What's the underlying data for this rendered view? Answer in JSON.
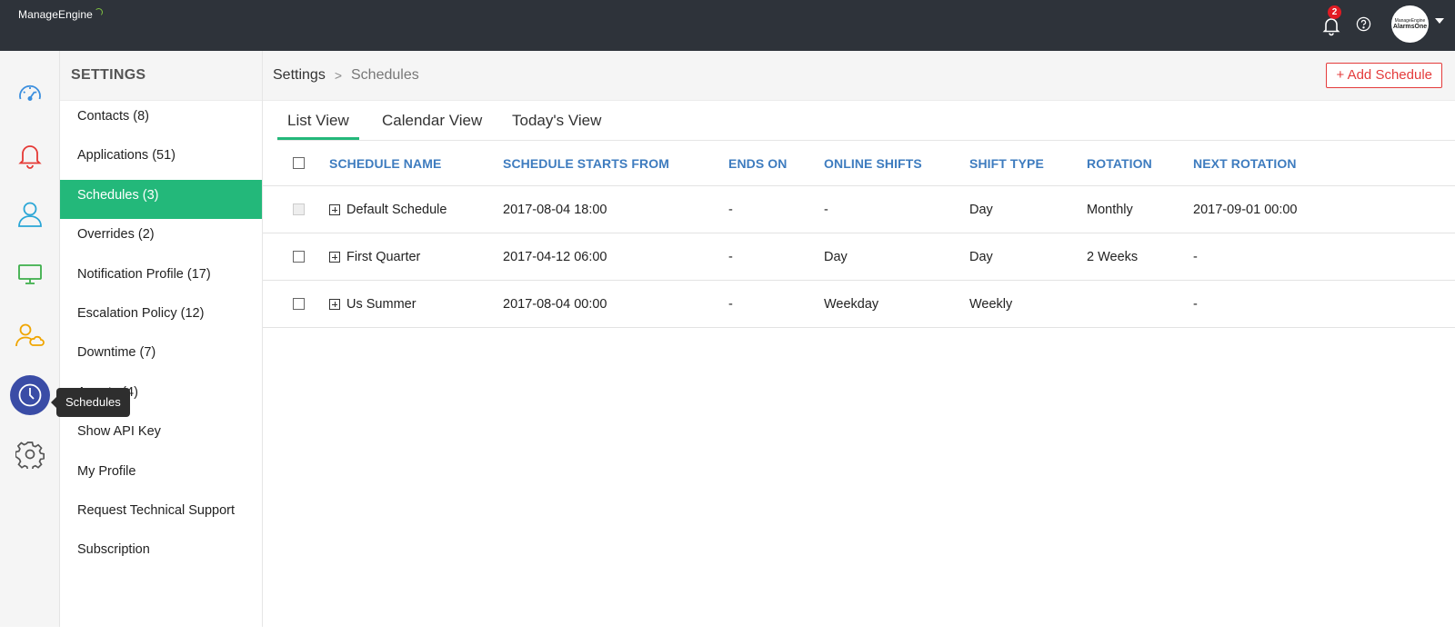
{
  "brand": {
    "vendor": "ManageEngine",
    "product": "AlarmsOne"
  },
  "topbar": {
    "notification_count": "2",
    "avatar_vendor": "ManageEngine",
    "avatar_product": "AlarmsOne"
  },
  "rail": {
    "items": [
      {
        "icon": "dashboard-gauge-icon",
        "color": "#3a8ede"
      },
      {
        "icon": "alarm-bell-icon",
        "color": "#e53935"
      },
      {
        "icon": "user-icon",
        "color": "#2aa6d6"
      },
      {
        "icon": "monitor-icon",
        "color": "#3cae4a"
      },
      {
        "icon": "users-cloud-icon",
        "color": "#f0a500"
      },
      {
        "icon": "clock-icon",
        "color": "#ffffff",
        "active": true
      },
      {
        "icon": "gear-icon",
        "color": "#555555"
      }
    ],
    "tooltip": "Schedules"
  },
  "settings": {
    "title": "SETTINGS",
    "items": [
      {
        "label": "Contacts (8)"
      },
      {
        "label": "Applications (51)"
      },
      {
        "label": "Schedules (3)",
        "active": true
      },
      {
        "label": "Overrides (2)"
      },
      {
        "label": "Notification Profile (17)"
      },
      {
        "label": "Escalation Policy (12)"
      },
      {
        "label": "Downtime (7)"
      },
      {
        "label": "Agents (4)"
      },
      {
        "label": "Show API Key"
      },
      {
        "label": "My Profile"
      },
      {
        "label": "Request Technical Support"
      },
      {
        "label": "Subscription"
      }
    ]
  },
  "breadcrumb": {
    "root": "Settings",
    "separator": ">",
    "current": "Schedules"
  },
  "add_button": "+ Add Schedule",
  "tabs": [
    {
      "label": "List View",
      "active": true
    },
    {
      "label": "Calendar View"
    },
    {
      "label": "Today's View"
    }
  ],
  "table": {
    "columns": [
      "SCHEDULE NAME",
      "SCHEDULE STARTS FROM",
      "ENDS ON",
      "ONLINE SHIFTS",
      "SHIFT TYPE",
      "ROTATION",
      "NEXT ROTATION"
    ],
    "rows": [
      {
        "name": "Default Schedule",
        "starts": "2017-08-04 18:00",
        "ends": "-",
        "online": "-",
        "shift_type": "Day",
        "rotation": "Monthly",
        "next_rotation": "2017-09-01 00:00"
      },
      {
        "name": "First Quarter",
        "starts": "2017-04-12 06:00",
        "ends": "-",
        "online": "Day",
        "shift_type": "Day",
        "rotation": "2 Weeks",
        "next_rotation": "-"
      },
      {
        "name": "Us Summer",
        "starts": "2017-08-04 00:00",
        "ends": "-",
        "online": "Weekday",
        "shift_type": "Weekly",
        "rotation": "",
        "next_rotation": "-"
      }
    ]
  },
  "colors": {
    "accent_green": "#23b87a",
    "topbar": "#2e333a",
    "header_blue": "#3e7cbf",
    "danger_red": "#e43b3b"
  }
}
